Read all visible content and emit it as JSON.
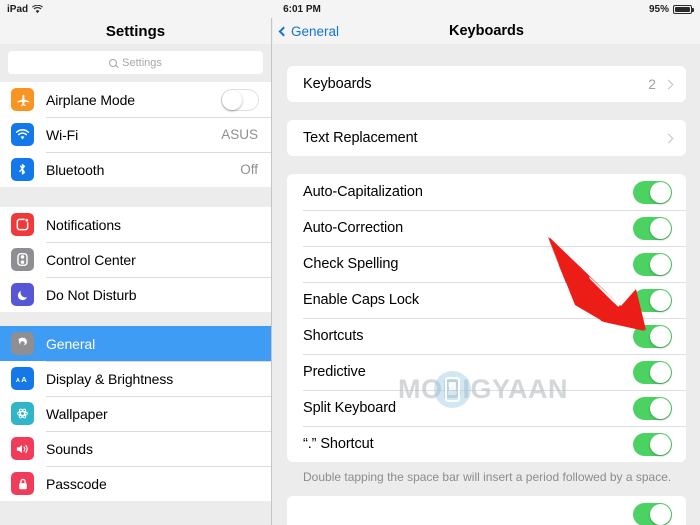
{
  "statusbar": {
    "device": "iPad",
    "wifi_icon": "wifi-icon",
    "time": "6:01 PM",
    "battery_percent": "95%",
    "battery_icon": "battery-icon"
  },
  "sidebar": {
    "title": "Settings",
    "search": {
      "placeholder": "Settings",
      "icon": "search-icon"
    },
    "groups": [
      {
        "items": [
          {
            "label": "Airplane Mode",
            "icon": "airplane-icon",
            "icon_color": "#f89422",
            "control": "toggle",
            "toggle_on": false
          },
          {
            "label": "Wi-Fi",
            "icon": "wifi-icon",
            "icon_color": "#1478e8",
            "control": "value",
            "value": "ASUS"
          },
          {
            "label": "Bluetooth",
            "icon": "bluetooth-icon",
            "icon_color": "#1478e8",
            "control": "value",
            "value": "Off"
          }
        ]
      },
      {
        "items": [
          {
            "label": "Notifications",
            "icon": "notifications-icon",
            "icon_color": "#f0393b",
            "control": "none"
          },
          {
            "label": "Control Center",
            "icon": "control-center-icon",
            "icon_color": "#8e8e93",
            "control": "none"
          },
          {
            "label": "Do Not Disturb",
            "icon": "moon-icon",
            "icon_color": "#5756d6",
            "control": "none"
          }
        ]
      },
      {
        "items": [
          {
            "label": "General",
            "icon": "gear-icon",
            "icon_color": "#8e8e93",
            "control": "none",
            "selected": true
          },
          {
            "label": "Display & Brightness",
            "icon": "display-brightness-icon",
            "icon_color": "#1478e8",
            "control": "none"
          },
          {
            "label": "Wallpaper",
            "icon": "wallpaper-icon",
            "icon_color": "#32b5c9",
            "control": "none"
          },
          {
            "label": "Sounds",
            "icon": "sounds-icon",
            "icon_color": "#f03c5a",
            "control": "none"
          },
          {
            "label": "Passcode",
            "icon": "passcode-icon",
            "icon_color": "#f03c5a",
            "control": "none"
          }
        ]
      }
    ],
    "selected_color": "#3e9cf4"
  },
  "detail": {
    "back_label": "General",
    "back_icon": "chevron-left-icon",
    "title": "Keyboards",
    "cards": [
      {
        "rows": [
          {
            "label": "Keyboards",
            "type": "disclosure",
            "value": "2",
            "chevron_icon": "chevron-right-icon"
          }
        ]
      },
      {
        "rows": [
          {
            "label": "Text Replacement",
            "type": "disclosure",
            "value": "",
            "chevron_icon": "chevron-right-icon"
          }
        ]
      },
      {
        "rows": [
          {
            "label": "Auto-Capitalization",
            "type": "toggle",
            "on": true
          },
          {
            "label": "Auto-Correction",
            "type": "toggle",
            "on": true
          },
          {
            "label": "Check Spelling",
            "type": "toggle",
            "on": true
          },
          {
            "label": "Enable Caps Lock",
            "type": "toggle",
            "on": true
          },
          {
            "label": "Shortcuts",
            "type": "toggle",
            "on": true
          },
          {
            "label": "Predictive",
            "type": "toggle",
            "on": true
          },
          {
            "label": "Split Keyboard",
            "type": "toggle",
            "on": true
          },
          {
            "label": "“.” Shortcut",
            "type": "toggle",
            "on": true
          }
        ],
        "footnote": "Double tapping the space bar will insert a period followed by a space."
      },
      {
        "rows": [
          {
            "label": "",
            "type": "toggle",
            "on": true
          }
        ]
      }
    ],
    "toggle_on_color": "#4cd263"
  },
  "annotation": {
    "arrow_icon": "red-arrow-icon",
    "arrow_color": "#ec1c16",
    "points_at": "Enable Caps Lock"
  },
  "watermark": {
    "text_left": "M",
    "text_right": "BIGYAAN",
    "full_text": "MOBIGYAAN",
    "icon": "mobile-phone-icon"
  }
}
